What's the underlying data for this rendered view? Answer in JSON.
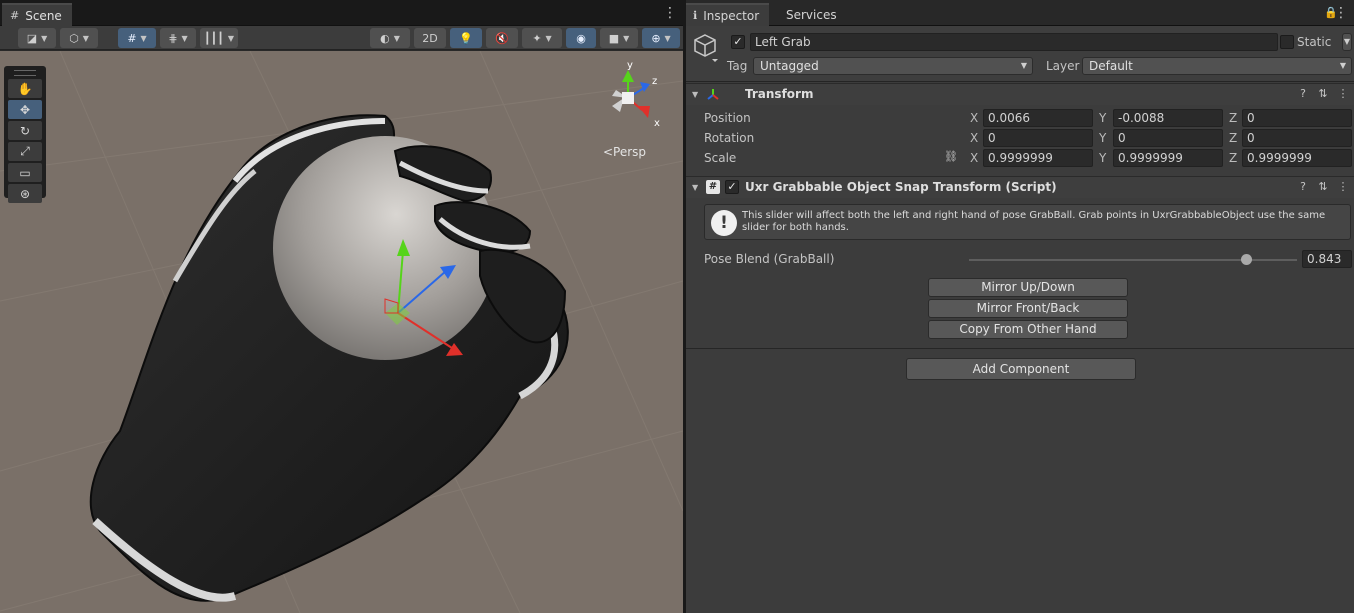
{
  "scene": {
    "tab_label": "Scene",
    "toolbar": {
      "mode_2d": "2D"
    },
    "persp_label": "<Persp",
    "gizmo_axes": {
      "y": "y",
      "z": "z",
      "x": "x"
    }
  },
  "inspector": {
    "tabs": [
      "Inspector",
      "Services"
    ],
    "object": {
      "active": true,
      "name": "Left Grab",
      "static_label": "Static",
      "tag_label": "Tag",
      "tag_value": "Untagged",
      "layer_label": "Layer",
      "layer_value": "Default"
    },
    "transform": {
      "title": "Transform",
      "rows": [
        {
          "label": "Position",
          "x": "0.0066",
          "y": "-0.0088",
          "z": "0"
        },
        {
          "label": "Rotation",
          "x": "0",
          "y": "0",
          "z": "0"
        },
        {
          "label": "Scale",
          "x": "0.9999999",
          "y": "0.9999999",
          "z": "0.9999999"
        }
      ],
      "axis_labels": {
        "x": "X",
        "y": "Y",
        "z": "Z"
      }
    },
    "script": {
      "title": "Uxr Grabbable Object Snap Transform (Script)",
      "enabled": true,
      "help_text": "This slider will affect both the left and right hand of pose GrabBall. Grab points in UxrGrabbableObject use the same slider for both hands.",
      "slider_label": "Pose Blend (GrabBall)",
      "slider_value": "0.843",
      "slider_fraction": 0.843,
      "buttons": [
        "Mirror Up/Down",
        "Mirror Front/Back",
        "Copy From Other Hand"
      ]
    },
    "add_component": "Add Component"
  },
  "colors": {
    "panel": "#3c3c3c",
    "viewport_ground": "#7a7068",
    "active_tool": "#46607c",
    "gizmo_x": "#e0302a",
    "gizmo_y": "#56d41a",
    "gizmo_z": "#2a68e8"
  }
}
